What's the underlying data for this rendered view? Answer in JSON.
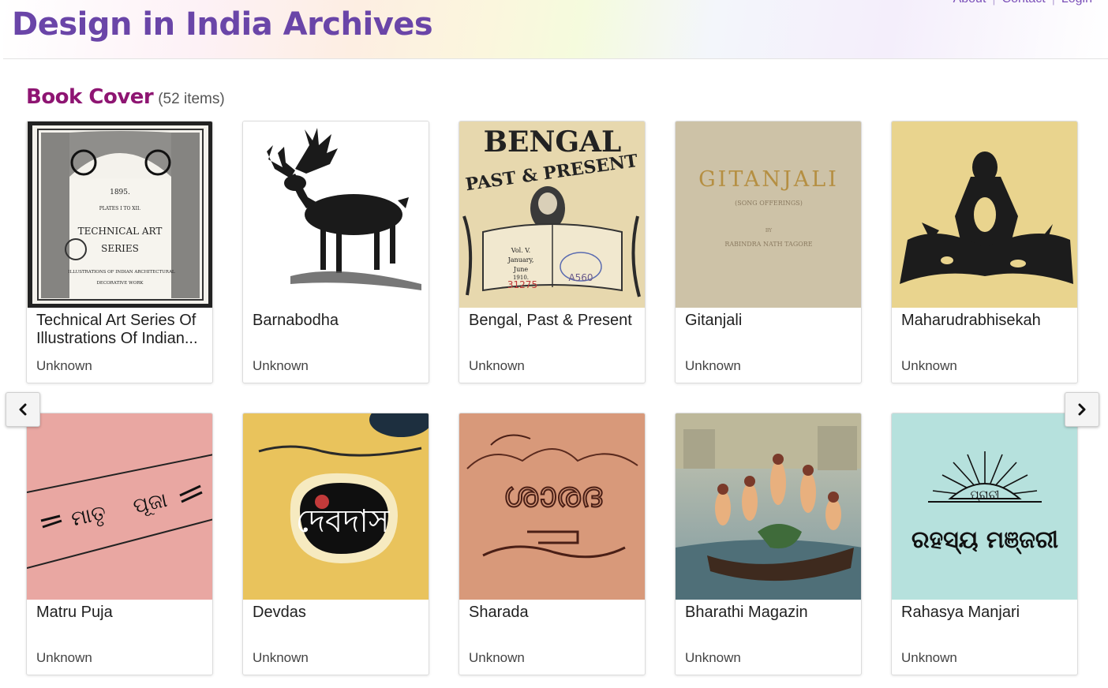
{
  "header": {
    "site_title": "Design in India Archives",
    "links": [
      "About",
      "Contact",
      "Login"
    ]
  },
  "section": {
    "title": "Book Cover",
    "count": "(52 items)"
  },
  "cards": [
    {
      "title": "Technical Art Series Of Illustrations Of Indian...",
      "author": "Unknown",
      "cover": {
        "name": "cover-technical-art",
        "bg": "#f2f0ea",
        "lines": [
          "1895.",
          "PLATES I TO XII.",
          "TECHNICAL ART",
          "SERIES",
          "ILLUSTRATIONS OF INDIAN ARCHITECTURAL",
          "DECORATIVE WORK"
        ]
      }
    },
    {
      "title": "Barnabodha",
      "author": "Unknown",
      "cover": {
        "name": "cover-barnabodha",
        "bg": "#ffffff",
        "lines": []
      }
    },
    {
      "title": "Bengal, Past & Present",
      "author": "Unknown",
      "cover": {
        "name": "cover-bengal",
        "bg": "#e8d9b0",
        "lines": [
          "BENGAL",
          "PAST & PRESENT",
          "Vol. V.",
          "January,",
          "June",
          "1910.",
          "31275",
          "A560"
        ]
      }
    },
    {
      "title": "Gitanjali",
      "author": "Unknown",
      "cover": {
        "name": "cover-gitanjali",
        "bg": "#d6cbb2",
        "lines": [
          "GITANJALI",
          "(SONG OFFERINGS)",
          "BY",
          "RABINDRA NATH TAGORE"
        ]
      }
    },
    {
      "title": "Maharudrabhisekah",
      "author": "Unknown",
      "cover": {
        "name": "cover-maharudrabhisekah",
        "bg": "#e9d48e",
        "lines": []
      }
    },
    {
      "title": "Matru Puja",
      "author": "Unknown",
      "cover": {
        "name": "cover-matru-puja",
        "bg": "#e8a5a0",
        "lines": [
          "ମାତୃ",
          "ପୂଜା"
        ]
      }
    },
    {
      "title": "Devdas",
      "author": "Unknown",
      "cover": {
        "name": "cover-devdas",
        "bg": "#e8c25a",
        "lines": [
          "দেবদাস"
        ]
      }
    },
    {
      "title": "Sharada",
      "author": "Unknown",
      "cover": {
        "name": "cover-sharada",
        "bg": "#d99a7a",
        "lines": [
          "ശാരദ"
        ]
      }
    },
    {
      "title": "Bharathi Magazin",
      "author": "Unknown",
      "cover": {
        "name": "cover-bharathi",
        "bg": "#8aa0a8",
        "lines": []
      }
    },
    {
      "title": "Rahasya Manjari",
      "author": "Unknown",
      "cover": {
        "name": "cover-rahasya-manjari",
        "bg": "#b5e0dc",
        "lines": [
          "ପ୍ରାଚୀ",
          "ରହସ୍ୟ ମଞ୍ଜରୀ"
        ]
      }
    }
  ],
  "nav": {
    "prev_icon": "chevron-left-icon",
    "next_icon": "chevron-right-icon"
  }
}
